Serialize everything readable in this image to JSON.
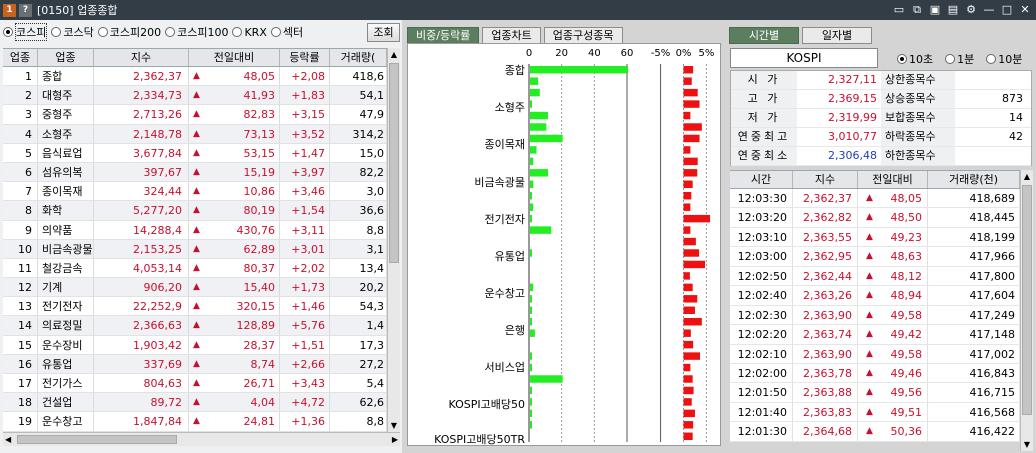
{
  "titlebar": {
    "badge1": "1",
    "badge2": "?",
    "title": "[0150] 업종종합",
    "icons": [
      "new-window-icon",
      "copy-icon",
      "save-icon",
      "lock-icon",
      "settings-icon",
      "minimize-icon",
      "maximize-icon",
      "close-icon"
    ]
  },
  "markets": {
    "options": [
      "코스피",
      "코스닥",
      "코스피200",
      "코스피100",
      "KRX",
      "섹터"
    ],
    "selected": "코스피",
    "query_button": "조회"
  },
  "sector_table": {
    "columns": [
      "업종",
      "업종",
      "지수",
      "전일대비",
      "등락률",
      "거래량("
    ],
    "rows": [
      {
        "no": "1",
        "name": "종합",
        "index": "2,362,37",
        "change": "48,05",
        "rate": "+2,08",
        "volume": "418,6"
      },
      {
        "no": "2",
        "name": "대형주",
        "index": "2,334,73",
        "change": "41,93",
        "rate": "+1,83",
        "volume": "54,1"
      },
      {
        "no": "3",
        "name": "중형주",
        "index": "2,713,26",
        "change": "82,83",
        "rate": "+3,15",
        "volume": "47,9"
      },
      {
        "no": "4",
        "name": "소형주",
        "index": "2,148,78",
        "change": "73,13",
        "rate": "+3,52",
        "volume": "314,2"
      },
      {
        "no": "5",
        "name": "음식료업",
        "index": "3,677,84",
        "change": "53,15",
        "rate": "+1,47",
        "volume": "15,0"
      },
      {
        "no": "6",
        "name": "섬유의복",
        "index": "397,67",
        "change": "15,19",
        "rate": "+3,97",
        "volume": "82,2"
      },
      {
        "no": "7",
        "name": "종이목재",
        "index": "324,44",
        "change": "10,86",
        "rate": "+3,46",
        "volume": "3,0"
      },
      {
        "no": "8",
        "name": "화학",
        "index": "5,277,20",
        "change": "80,19",
        "rate": "+1,54",
        "volume": "36,6"
      },
      {
        "no": "9",
        "name": "의약품",
        "index": "14,288,4",
        "change": "430,76",
        "rate": "+3,11",
        "volume": "8,8"
      },
      {
        "no": "10",
        "name": "비금속광물",
        "index": "2,153,25",
        "change": "62,89",
        "rate": "+3,01",
        "volume": "3,1"
      },
      {
        "no": "11",
        "name": "철강금속",
        "index": "4,053,14",
        "change": "80,37",
        "rate": "+2,02",
        "volume": "13,4"
      },
      {
        "no": "12",
        "name": "기계",
        "index": "906,20",
        "change": "15,40",
        "rate": "+1,73",
        "volume": "20,2"
      },
      {
        "no": "13",
        "name": "전기전자",
        "index": "22,252,9",
        "change": "320,15",
        "rate": "+1,46",
        "volume": "54,3"
      },
      {
        "no": "14",
        "name": "의료정밀",
        "index": "2,366,63",
        "change": "128,89",
        "rate": "+5,76",
        "volume": "1,4"
      },
      {
        "no": "15",
        "name": "운수장비",
        "index": "1,903,42",
        "change": "28,37",
        "rate": "+1,51",
        "volume": "17,3"
      },
      {
        "no": "16",
        "name": "유통업",
        "index": "337,69",
        "change": "8,74",
        "rate": "+2,66",
        "volume": "27,2"
      },
      {
        "no": "17",
        "name": "전기가스",
        "index": "804,63",
        "change": "26,71",
        "rate": "+3,43",
        "volume": "5,4"
      },
      {
        "no": "18",
        "name": "건설업",
        "index": "89,72",
        "change": "4,04",
        "rate": "+4,72",
        "volume": "62,6"
      },
      {
        "no": "19",
        "name": "운수창고",
        "index": "1,847,84",
        "change": "24,81",
        "rate": "+1,36",
        "volume": "8,8"
      }
    ]
  },
  "mid_tabs": [
    "비중/등락률",
    "업종차트",
    "업종구성종목"
  ],
  "chart_data": {
    "type": "bar",
    "labels": [
      "종합",
      "소형주",
      "종이목재",
      "비금속광물",
      "전기전자",
      "유통업",
      "운수창고",
      "은행",
      "서비스업",
      "KOSPI고배당50",
      "KOSPI고배당50TR"
    ],
    "weight_axis_ticks": [
      "0",
      "20",
      "40",
      "60"
    ],
    "rate_axis_ticks": [
      "-5%",
      "0%",
      "5%"
    ],
    "weight_xlim": [
      0,
      60
    ],
    "rate_xlim": [
      -6,
      6
    ],
    "colors": {
      "weight": "#22ee22",
      "rate": "#ee1111"
    },
    "weight": [
      60,
      5,
      6,
      1,
      11,
      10,
      20,
      4,
      2,
      11,
      2,
      1,
      2,
      1,
      13,
      0,
      1,
      0,
      0,
      2,
      1,
      1,
      1,
      3,
      0,
      1,
      1,
      20,
      1,
      1,
      1,
      1,
      0
    ],
    "rate": [
      2.1,
      1.8,
      3.1,
      3.5,
      1.5,
      4.0,
      3.5,
      1.5,
      3.1,
      3.0,
      2.0,
      1.7,
      1.5,
      5.8,
      1.5,
      2.7,
      3.4,
      4.7,
      1.4,
      2.0,
      3.0,
      2.5,
      4.0,
      1.6,
      2.1,
      3.6,
      1.5,
      2.0,
      2.2,
      1.8,
      2.5,
      2.1,
      2.0
    ]
  },
  "right_tabs": [
    "시간별",
    "일자별"
  ],
  "index_name": "KOSPI",
  "intervals": {
    "options": [
      "10초",
      "1분",
      "10분"
    ],
    "selected": "10초"
  },
  "summary": [
    {
      "label": "시 가",
      "value": "2,327,11",
      "label2": "상한종목수",
      "value2": ""
    },
    {
      "label": "고 가",
      "value": "2,369,15",
      "label2": "상승종목수",
      "value2": "873"
    },
    {
      "label": "저 가",
      "value": "2,319,99",
      "label2": "보합종목수",
      "value2": "14"
    },
    {
      "label": "연중최고",
      "value": "3,010,77",
      "label2": "하락종목수",
      "value2": "42"
    },
    {
      "label": "연중최소",
      "value": "2,306,48",
      "label2": "하한종목수",
      "value2": ""
    }
  ],
  "time_table": {
    "columns": [
      "시간",
      "지수",
      "전일대비",
      "거래량(천)"
    ],
    "rows": [
      {
        "time": "12:03:30",
        "index": "2,362,37",
        "change": "48,05",
        "volume": "418,689"
      },
      {
        "time": "12:03:20",
        "index": "2,362,82",
        "change": "48,50",
        "volume": "418,445"
      },
      {
        "time": "12:03:10",
        "index": "2,363,55",
        "change": "49,23",
        "volume": "418,199"
      },
      {
        "time": "12:03:00",
        "index": "2,362,95",
        "change": "48,63",
        "volume": "417,966"
      },
      {
        "time": "12:02:50",
        "index": "2,362,44",
        "change": "48,12",
        "volume": "417,800"
      },
      {
        "time": "12:02:40",
        "index": "2,363,26",
        "change": "48,94",
        "volume": "417,604"
      },
      {
        "time": "12:02:30",
        "index": "2,363,90",
        "change": "49,58",
        "volume": "417,249"
      },
      {
        "time": "12:02:20",
        "index": "2,363,74",
        "change": "49,42",
        "volume": "417,148"
      },
      {
        "time": "12:02:10",
        "index": "2,363,90",
        "change": "49,58",
        "volume": "417,002"
      },
      {
        "time": "12:02:00",
        "index": "2,363,78",
        "change": "49,46",
        "volume": "416,843"
      },
      {
        "time": "12:01:50",
        "index": "2,363,88",
        "change": "49,56",
        "volume": "416,715"
      },
      {
        "time": "12:01:40",
        "index": "2,363,83",
        "change": "49,51",
        "volume": "416,568"
      },
      {
        "time": "12:01:30",
        "index": "2,364,68",
        "change": "50,36",
        "volume": "416,422"
      }
    ]
  },
  "colors": {
    "up": "#c8102e",
    "down": "#1f3fb0",
    "title_bg": "#333d46",
    "tab_active": "#5b7e5f"
  }
}
